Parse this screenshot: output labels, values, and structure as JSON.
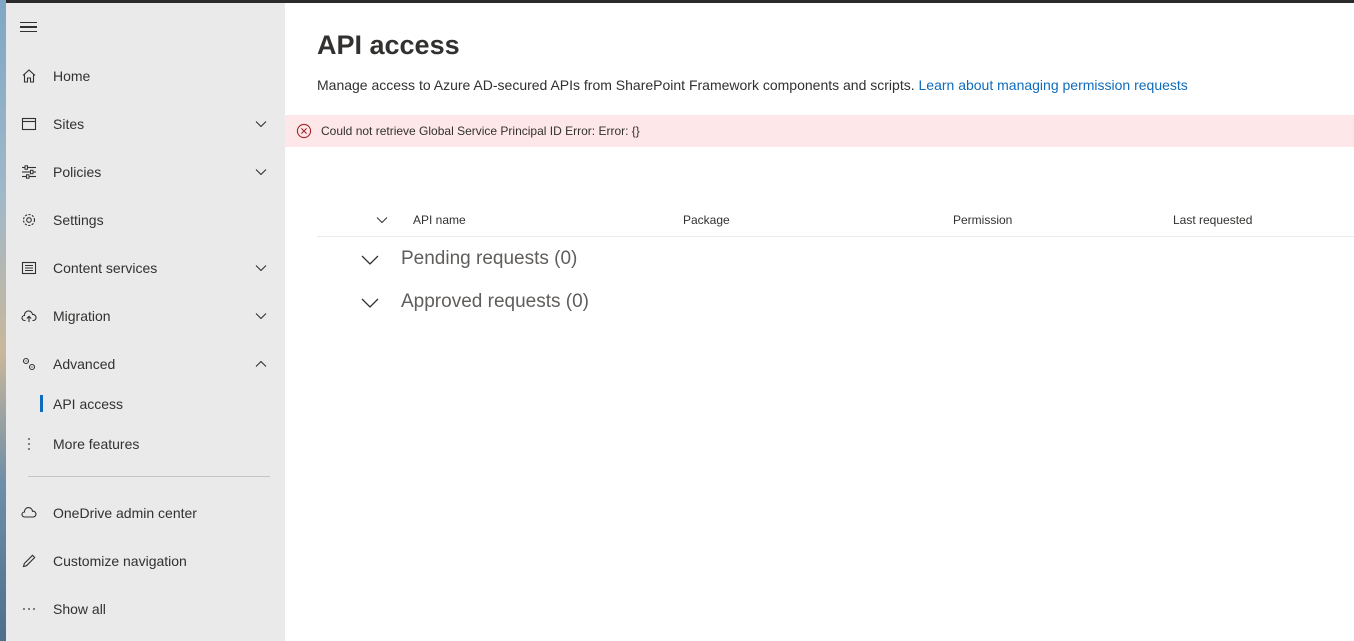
{
  "sidebar": {
    "items": [
      {
        "label": "Home"
      },
      {
        "label": "Sites"
      },
      {
        "label": "Policies"
      },
      {
        "label": "Settings"
      },
      {
        "label": "Content services"
      },
      {
        "label": "Migration"
      },
      {
        "label": "Advanced"
      }
    ],
    "sub_items": [
      {
        "label": "API access"
      },
      {
        "label": "More features"
      }
    ],
    "footer_items": [
      {
        "label": "OneDrive admin center"
      },
      {
        "label": "Customize navigation"
      },
      {
        "label": "Show all"
      }
    ]
  },
  "main": {
    "title": "API access",
    "description": "Manage access to Azure AD-secured APIs from SharePoint Framework components and scripts.",
    "learn_link": "Learn about managing permission requests",
    "error_message": "Could not retrieve Global Service Principal ID Error: Error: {}",
    "columns": [
      "API name",
      "Package",
      "Permission",
      "Last requested"
    ],
    "groups": [
      {
        "label": "Pending requests (0)"
      },
      {
        "label": "Approved requests (0)"
      }
    ]
  },
  "colors": {
    "accent": "#0f6cbd",
    "error_bg": "#fde7e9",
    "error_icon": "#a4262c",
    "sidebar_bg": "#eaeaea"
  }
}
